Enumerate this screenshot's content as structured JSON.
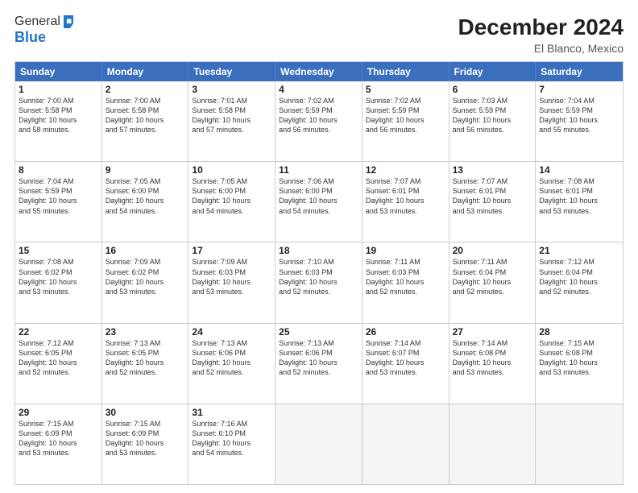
{
  "logo": {
    "line1": "General",
    "line2": "Blue"
  },
  "header": {
    "title": "December 2024",
    "subtitle": "El Blanco, Mexico"
  },
  "days_of_week": [
    "Sunday",
    "Monday",
    "Tuesday",
    "Wednesday",
    "Thursday",
    "Friday",
    "Saturday"
  ],
  "weeks": [
    [
      {
        "day": "1",
        "info": "Sunrise: 7:00 AM\nSunset: 5:58 PM\nDaylight: 10 hours\nand 58 minutes."
      },
      {
        "day": "2",
        "info": "Sunrise: 7:00 AM\nSunset: 5:58 PM\nDaylight: 10 hours\nand 57 minutes."
      },
      {
        "day": "3",
        "info": "Sunrise: 7:01 AM\nSunset: 5:58 PM\nDaylight: 10 hours\nand 57 minutes."
      },
      {
        "day": "4",
        "info": "Sunrise: 7:02 AM\nSunset: 5:59 PM\nDaylight: 10 hours\nand 56 minutes."
      },
      {
        "day": "5",
        "info": "Sunrise: 7:02 AM\nSunset: 5:59 PM\nDaylight: 10 hours\nand 56 minutes."
      },
      {
        "day": "6",
        "info": "Sunrise: 7:03 AM\nSunset: 5:59 PM\nDaylight: 10 hours\nand 56 minutes."
      },
      {
        "day": "7",
        "info": "Sunrise: 7:04 AM\nSunset: 5:59 PM\nDaylight: 10 hours\nand 55 minutes."
      }
    ],
    [
      {
        "day": "8",
        "info": "Sunrise: 7:04 AM\nSunset: 5:59 PM\nDaylight: 10 hours\nand 55 minutes."
      },
      {
        "day": "9",
        "info": "Sunrise: 7:05 AM\nSunset: 6:00 PM\nDaylight: 10 hours\nand 54 minutes."
      },
      {
        "day": "10",
        "info": "Sunrise: 7:05 AM\nSunset: 6:00 PM\nDaylight: 10 hours\nand 54 minutes."
      },
      {
        "day": "11",
        "info": "Sunrise: 7:06 AM\nSunset: 6:00 PM\nDaylight: 10 hours\nand 54 minutes."
      },
      {
        "day": "12",
        "info": "Sunrise: 7:07 AM\nSunset: 6:01 PM\nDaylight: 10 hours\nand 53 minutes."
      },
      {
        "day": "13",
        "info": "Sunrise: 7:07 AM\nSunset: 6:01 PM\nDaylight: 10 hours\nand 53 minutes."
      },
      {
        "day": "14",
        "info": "Sunrise: 7:08 AM\nSunset: 6:01 PM\nDaylight: 10 hours\nand 53 minutes."
      }
    ],
    [
      {
        "day": "15",
        "info": "Sunrise: 7:08 AM\nSunset: 6:02 PM\nDaylight: 10 hours\nand 53 minutes."
      },
      {
        "day": "16",
        "info": "Sunrise: 7:09 AM\nSunset: 6:02 PM\nDaylight: 10 hours\nand 53 minutes."
      },
      {
        "day": "17",
        "info": "Sunrise: 7:09 AM\nSunset: 6:03 PM\nDaylight: 10 hours\nand 53 minutes."
      },
      {
        "day": "18",
        "info": "Sunrise: 7:10 AM\nSunset: 6:03 PM\nDaylight: 10 hours\nand 52 minutes."
      },
      {
        "day": "19",
        "info": "Sunrise: 7:11 AM\nSunset: 6:03 PM\nDaylight: 10 hours\nand 52 minutes."
      },
      {
        "day": "20",
        "info": "Sunrise: 7:11 AM\nSunset: 6:04 PM\nDaylight: 10 hours\nand 52 minutes."
      },
      {
        "day": "21",
        "info": "Sunrise: 7:12 AM\nSunset: 6:04 PM\nDaylight: 10 hours\nand 52 minutes."
      }
    ],
    [
      {
        "day": "22",
        "info": "Sunrise: 7:12 AM\nSunset: 6:05 PM\nDaylight: 10 hours\nand 52 minutes."
      },
      {
        "day": "23",
        "info": "Sunrise: 7:13 AM\nSunset: 6:05 PM\nDaylight: 10 hours\nand 52 minutes."
      },
      {
        "day": "24",
        "info": "Sunrise: 7:13 AM\nSunset: 6:06 PM\nDaylight: 10 hours\nand 52 minutes."
      },
      {
        "day": "25",
        "info": "Sunrise: 7:13 AM\nSunset: 6:06 PM\nDaylight: 10 hours\nand 52 minutes."
      },
      {
        "day": "26",
        "info": "Sunrise: 7:14 AM\nSunset: 6:07 PM\nDaylight: 10 hours\nand 53 minutes."
      },
      {
        "day": "27",
        "info": "Sunrise: 7:14 AM\nSunset: 6:08 PM\nDaylight: 10 hours\nand 53 minutes."
      },
      {
        "day": "28",
        "info": "Sunrise: 7:15 AM\nSunset: 6:08 PM\nDaylight: 10 hours\nand 53 minutes."
      }
    ],
    [
      {
        "day": "29",
        "info": "Sunrise: 7:15 AM\nSunset: 6:09 PM\nDaylight: 10 hours\nand 53 minutes."
      },
      {
        "day": "30",
        "info": "Sunrise: 7:15 AM\nSunset: 6:09 PM\nDaylight: 10 hours\nand 53 minutes."
      },
      {
        "day": "31",
        "info": "Sunrise: 7:16 AM\nSunset: 6:10 PM\nDaylight: 10 hours\nand 54 minutes."
      },
      {
        "day": "",
        "info": ""
      },
      {
        "day": "",
        "info": ""
      },
      {
        "day": "",
        "info": ""
      },
      {
        "day": "",
        "info": ""
      }
    ]
  ]
}
